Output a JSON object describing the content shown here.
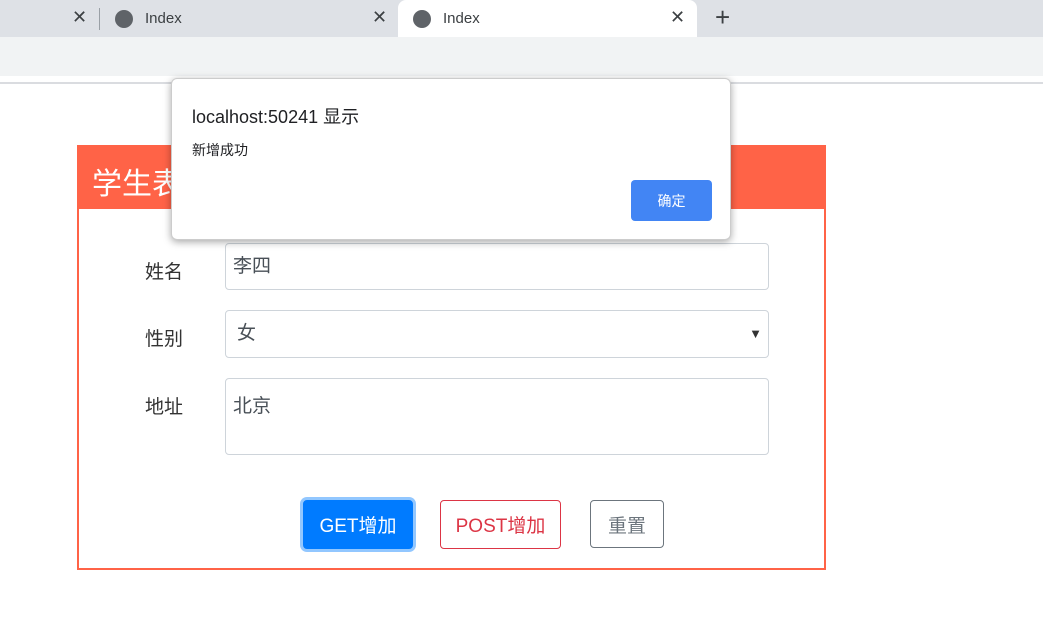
{
  "browser": {
    "tabs": [
      {
        "label": "Index"
      },
      {
        "label": "Index",
        "active": true
      }
    ],
    "new_tab": "+",
    "close": "✕"
  },
  "form": {
    "title": "学生表",
    "name_label": "姓名",
    "name_value": "李四",
    "gender_label": "性别",
    "gender_value": "女",
    "address_label": "地址",
    "address_value": "北京",
    "get_button": "GET增加",
    "post_button": "POST增加",
    "reset_button": "重置"
  },
  "dialog": {
    "title": "localhost:50241 显示",
    "message": "新增成功",
    "ok": "确定"
  },
  "colors": {
    "accent": "#ff6347",
    "primary": "#007bff",
    "danger": "#dc3545",
    "dialog_button": "#4285f4"
  }
}
